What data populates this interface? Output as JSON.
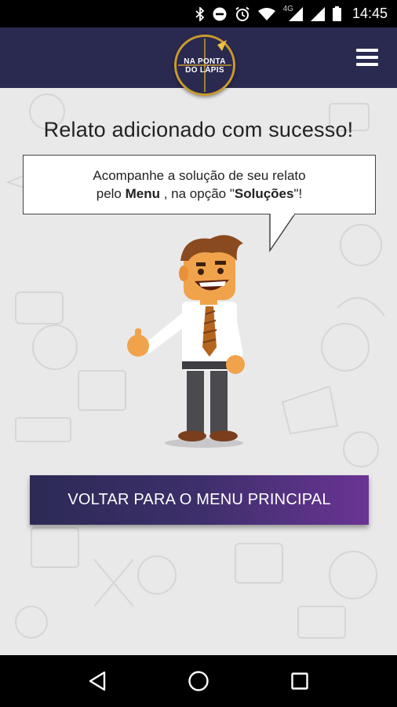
{
  "status_bar": {
    "time": "14:45",
    "network": "4G",
    "icons": [
      "bluetooth-icon",
      "do-not-disturb-icon",
      "alarm-icon",
      "wifi-icon",
      "cell-signal-icon",
      "battery-icon"
    ]
  },
  "header": {
    "logo_line1": "NA PONTA",
    "logo_line2": "DO LÁPIS",
    "menu_icon": "hamburger-menu-icon"
  },
  "main": {
    "title": "Relato adicionado com sucesso!",
    "bubble_line1": "Acompanhe a solução de seu relato",
    "bubble_line2_prefix": "pelo ",
    "bubble_line2_menu": "Menu",
    "bubble_line2_middle": " , na opção \"",
    "bubble_line2_solutions": "Soluções",
    "bubble_line2_suffix": "\"!",
    "cta_label": "VOLTAR PARA O MENU PRINCIPAL"
  },
  "nav": {
    "back_icon": "back-triangle-icon",
    "home_icon": "home-circle-icon",
    "recents_icon": "recents-square-icon"
  },
  "colors": {
    "header_bg": "#2a2950",
    "logo_ring": "#c99a2e",
    "cta_start": "#2c2a55",
    "cta_end": "#6a3494",
    "page_bg": "#e9e9ea"
  }
}
